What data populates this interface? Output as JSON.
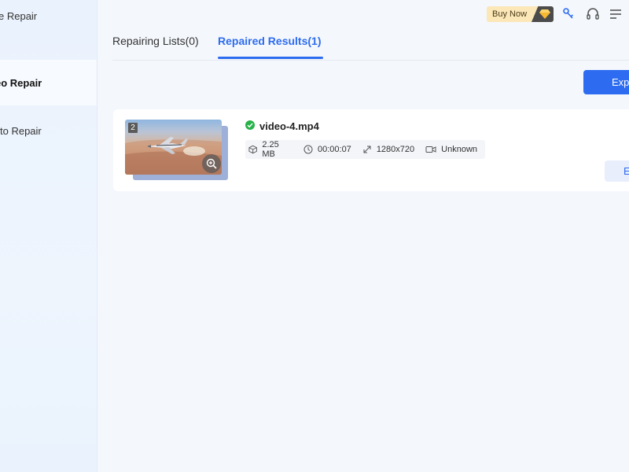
{
  "sidebar": {
    "items": [
      {
        "label": "e Repair"
      },
      {
        "label": "eo Repair"
      },
      {
        "label": "to Repair"
      }
    ]
  },
  "header": {
    "buy_now": "Buy Now"
  },
  "tabs": [
    {
      "label": "Repairing Lists(0)"
    },
    {
      "label": "Repaired Results(1)"
    }
  ],
  "toolbar": {
    "export_all_label": "Expo"
  },
  "results": [
    {
      "badge": "2",
      "file_name": "video-4.mp4",
      "size": "2.25 MB",
      "duration": "00:00:07",
      "resolution": "1280x720",
      "codec": "Unknown",
      "export_label": "E"
    }
  ],
  "colors": {
    "accent": "#2d6cf0",
    "success": "#27b24a",
    "buy_now_bg": "#fbe7b8"
  }
}
